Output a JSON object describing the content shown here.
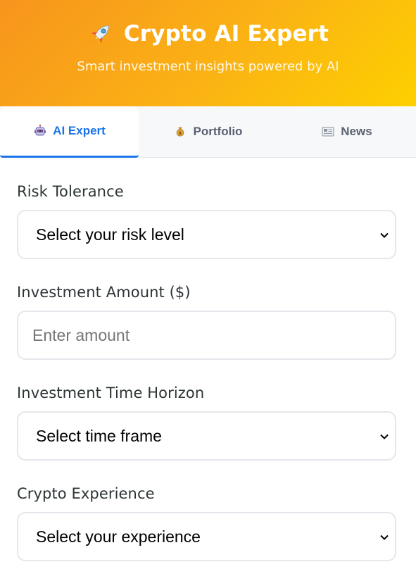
{
  "header": {
    "title": "Crypto AI Expert",
    "subtitle": "Smart investment insights powered by AI",
    "icon": "rocket-icon",
    "gradient_start": "#f7941d",
    "gradient_end": "#fdd000"
  },
  "tabs": [
    {
      "label": "AI Expert",
      "icon": "robot-icon",
      "active": true
    },
    {
      "label": "Portfolio",
      "icon": "money-bag-icon",
      "active": false
    },
    {
      "label": "News",
      "icon": "newspaper-icon",
      "active": false
    }
  ],
  "accent_color": "#1a73e8",
  "form": {
    "risk_tolerance": {
      "label": "Risk Tolerance",
      "selected": "Select your risk level"
    },
    "investment_amount": {
      "label": "Investment Amount ($)",
      "placeholder": "Enter amount",
      "value": ""
    },
    "time_horizon": {
      "label": "Investment Time Horizon",
      "selected": "Select time frame"
    },
    "experience": {
      "label": "Crypto Experience",
      "selected": "Select your experience"
    }
  }
}
